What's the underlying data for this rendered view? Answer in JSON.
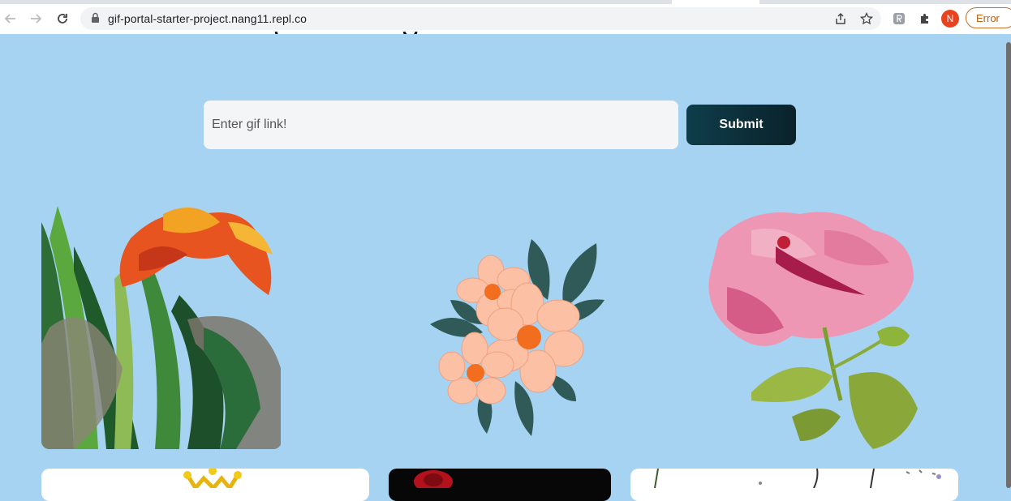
{
  "browser": {
    "url": "gif-portal-starter-project.nang11.repl.co",
    "profile_initial": "N",
    "error_label": "Error"
  },
  "page": {
    "input_placeholder": "Enter gif link!",
    "submit_label": "Submit",
    "gifs": [
      {
        "subject": "orange lily with green leaves"
      },
      {
        "subject": "peach flower bouquet"
      },
      {
        "subject": "pink hibiscus watercolor"
      },
      {
        "subject": "crown"
      },
      {
        "subject": "red rose"
      },
      {
        "subject": "sketched flowers"
      }
    ]
  },
  "colors": {
    "page_background": "#a6d3f2",
    "submit_button": "#0d2f38",
    "avatar": "#e8431e"
  }
}
